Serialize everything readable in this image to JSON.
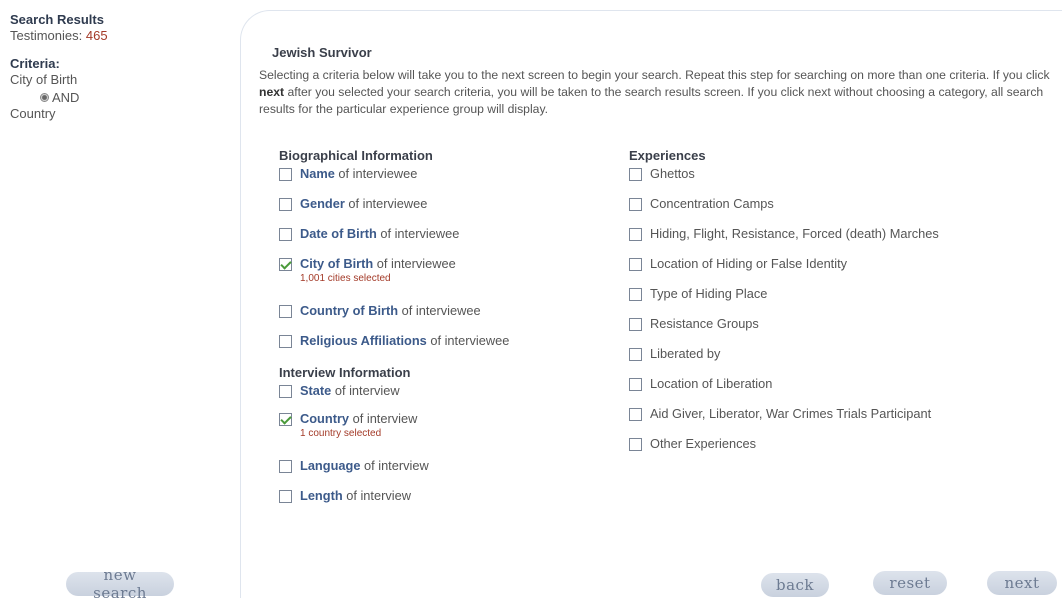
{
  "sidebar": {
    "title": "Search Results",
    "count_label": "Testimonies:",
    "count_value": "465",
    "criteria_label": "Criteria:",
    "criteria_1": "City of Birth",
    "operator": "AND",
    "criteria_2": "Country",
    "new_search": "new search"
  },
  "main": {
    "title": "Jewish Survivor",
    "intro_1": "Selecting a criteria below will take you to the next screen to begin your search. Repeat this step for searching on more than one criteria. If you click ",
    "intro_bold": "next",
    "intro_2": " after you selected your search criteria, you will be taken to the search results screen. If you click next without choosing a category, all search results for the particular experience group will display.",
    "bio_heading": "Biographical Information",
    "bio": [
      {
        "bold": "Name",
        "rest": " of interviewee",
        "checked": false,
        "note": ""
      },
      {
        "bold": "Gender",
        "rest": " of interviewee",
        "checked": false,
        "note": ""
      },
      {
        "bold": "Date of Birth",
        "rest": " of interviewee",
        "checked": false,
        "note": ""
      },
      {
        "bold": "City of Birth",
        "rest": " of interviewee",
        "checked": true,
        "note": "1,001 cities selected"
      },
      {
        "bold": "Country of Birth",
        "rest": " of interviewee",
        "checked": false,
        "note": ""
      },
      {
        "bold": "Religious Affiliations",
        "rest": " of interviewee",
        "checked": false,
        "note": ""
      }
    ],
    "interview_heading": "Interview Information",
    "interview": [
      {
        "bold": "State",
        "rest": " of interview",
        "checked": false,
        "note": ""
      },
      {
        "bold": "Country",
        "rest": " of interview",
        "checked": true,
        "note": "1 country selected"
      },
      {
        "bold": "Language",
        "rest": " of interview",
        "checked": false,
        "note": ""
      },
      {
        "bold": "Length",
        "rest": " of interview",
        "checked": false,
        "note": ""
      }
    ],
    "exp_heading": "Experiences",
    "experiences": [
      "Ghettos",
      "Concentration Camps",
      "Hiding, Flight, Resistance, Forced (death) Marches",
      "Location of Hiding or False Identity",
      "Type of Hiding Place",
      "Resistance Groups",
      "Liberated by",
      "Location of Liberation",
      "Aid Giver, Liberator, War Crimes Trials Participant",
      "Other Experiences"
    ],
    "back": "back",
    "reset": "reset",
    "next": "next"
  }
}
